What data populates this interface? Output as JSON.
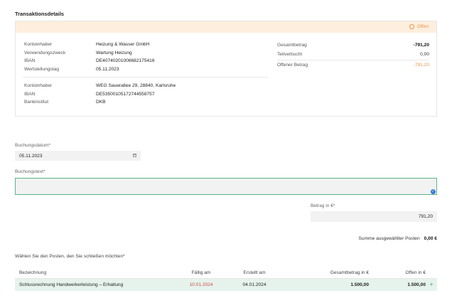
{
  "section_title": "Transaktionsdetails",
  "status": {
    "label": "Offen",
    "color": "#e8954a",
    "icon": "clock-icon"
  },
  "sender": {
    "rows": [
      {
        "label": "Kontoinhaber",
        "value": "Heizung & Wasser GmbH"
      },
      {
        "label": "Verwendungszweck",
        "value": "Wartung Heizung"
      },
      {
        "label": "IBAN",
        "value": "DE40740201006682175416"
      },
      {
        "label": "Wertstellungstag",
        "value": "05.11.2023"
      }
    ]
  },
  "receiver": {
    "rows": [
      {
        "label": "Kontoinhaber",
        "value": "WEG Sauerallee 29, 28840, Karlsruhe"
      },
      {
        "label": "IBAN",
        "value": "DE53500105172744558757"
      },
      {
        "label": "Bankinstitut",
        "value": "DKB"
      }
    ]
  },
  "totals": {
    "gesamt_label": "Gesamtbetrag",
    "gesamt_value": "-791,20",
    "teil_label": "Teilverbucht",
    "teil_value": "0,00",
    "offen_label": "Offener Betrag",
    "offen_value": "-791,20"
  },
  "form": {
    "date_label": "Buchungsdatum*",
    "date_value": "05.11.2023",
    "text_label": "Buchungstext*",
    "text_value": "",
    "amount_label": "Betrag in €*",
    "amount_value": "791,20"
  },
  "sum": {
    "label": "Summe ausgewählter Posten",
    "value": "0,00 €"
  },
  "choose_label": "Wählen Sie den Posten, den Sie schließen möchten*",
  "table": {
    "headers": [
      "Bezeichnung",
      "Fällig am",
      "Erstellt am",
      "Gesamtbetrag in €",
      "Offen in €"
    ],
    "rows": [
      {
        "name": "Schlussrechnung Handwerkerleistung – Erhaltung",
        "due": "10.01.2024",
        "created": "04.01.2024",
        "total": "1.500,00",
        "open": "1.500,00"
      }
    ]
  },
  "colors": {
    "accent": "#5ab48a",
    "warning": "#e8954a",
    "overdue": "#d04848"
  }
}
